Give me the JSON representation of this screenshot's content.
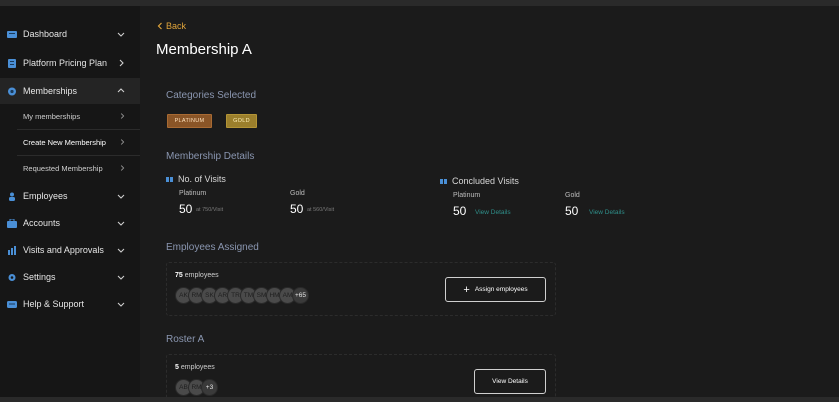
{
  "sidebar": {
    "items": [
      {
        "label": "Dashboard",
        "icon": "dashboard-icon",
        "chevron": "down"
      },
      {
        "label": "Platform Pricing Plan",
        "icon": "pricing-icon",
        "chevron": "right"
      },
      {
        "label": "Memberships",
        "icon": "memberships-icon",
        "chevron": "up"
      },
      {
        "label": "Employees",
        "icon": "employees-icon",
        "chevron": "down"
      },
      {
        "label": "Accounts",
        "icon": "accounts-icon",
        "chevron": "down"
      },
      {
        "label": "Visits and Approvals",
        "icon": "visits-icon",
        "chevron": "down"
      },
      {
        "label": "Settings",
        "icon": "settings-icon",
        "chevron": "down"
      },
      {
        "label": "Help & Support",
        "icon": "help-icon",
        "chevron": "down"
      }
    ],
    "sub_items": [
      {
        "label": "My memberships"
      },
      {
        "label": "Create New Membership"
      },
      {
        "label": "Requested Membership"
      }
    ]
  },
  "back_label": "Back",
  "page_title": "Membership A",
  "categories": {
    "title": "Categories Selected",
    "chips": [
      "PLATINUM",
      "GOLD"
    ]
  },
  "details": {
    "title": "Membership Details",
    "no_of_visits": {
      "heading": "No. of Visits",
      "platinum_label": "Platinum",
      "platinum_value": "50",
      "platinum_note": "at 750/Visit",
      "gold_label": "Gold",
      "gold_value": "50",
      "gold_note": "at 560/Visit"
    },
    "concluded": {
      "heading": "Concluded Visits",
      "platinum_label": "Platinum",
      "platinum_value": "50",
      "platinum_link": "View Details",
      "gold_label": "Gold",
      "gold_value": "50",
      "gold_link": "View Details"
    }
  },
  "employees_assigned": {
    "title": "Employees Assigned",
    "count": "75",
    "count_suffix": "employees",
    "avatars": [
      "AK",
      "RM",
      "SK",
      "AR",
      "TR",
      "TM",
      "SM",
      "HM",
      "AM"
    ],
    "more": "+65",
    "button_label": "Assign employees"
  },
  "roster": {
    "title": "Roster A",
    "count": "5",
    "count_suffix": "employees",
    "avatars": [
      "AB",
      "RM"
    ],
    "more": "+3",
    "button_label": "View Details"
  },
  "colors": {
    "accent": "#e0a43a",
    "link": "#2f8f8a",
    "platinum": "#8a5527",
    "gold": "#9b7f2c"
  }
}
